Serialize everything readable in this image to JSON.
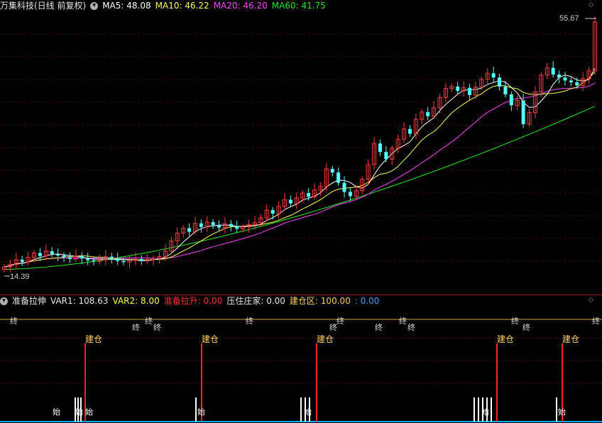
{
  "main_header": {
    "title": "万集科技(日线 前复权)",
    "ma5_label": "MA5:",
    "ma5_value": "48.08",
    "ma10_label": "MA10:",
    "ma10_value": "46.22",
    "ma20_label": "MA20:",
    "ma20_value": "46.20",
    "ma60_label": "MA60:",
    "ma60_value": "41.75"
  },
  "indicator_header": {
    "name": "准备拉伸",
    "var1_label": "VAR1:",
    "var1_value": "108.63",
    "var2_label": "VAR2:",
    "var2_value": "8.00",
    "pull_label": "准备拉升:",
    "pull_value": "0.00",
    "press_label": "压住庄家:",
    "press_value": "0.00",
    "build_label": "建仓区:",
    "build_value": "100.00",
    "extra_value": ": 0.00"
  },
  "price_labels": {
    "high": "55.67",
    "low": "14.39"
  },
  "annotations": {
    "build": "建仓",
    "start": "始",
    "end": "终"
  },
  "colors": {
    "up": "#ff3c3c",
    "down": "#54ffff",
    "ma5": "#ffffff",
    "ma10": "#ffff54",
    "ma20": "#ff44ff",
    "ma60": "#22ee22",
    "grid": "#5a1010",
    "build_bar": "#ff2020",
    "axis_line": "#00aaff"
  },
  "chart_data": {
    "type": "candlestick",
    "price_range": [
      14.39,
      55.67
    ],
    "close_series": [
      15.2,
      15.6,
      16.4,
      16.0,
      16.8,
      17.5,
      17.0,
      17.8,
      17.3,
      17.1,
      16.8,
      16.5,
      17.0,
      16.6,
      16.3,
      16.1,
      16.4,
      16.9,
      16.6,
      16.2,
      16.0,
      16.3,
      16.5,
      16.2,
      16.4,
      16.6,
      16.9,
      17.8,
      19.5,
      20.8,
      21.6,
      21.0,
      22.4,
      21.8,
      22.6,
      22.1,
      21.7,
      22.3,
      21.9,
      21.5,
      21.8,
      22.2,
      22.5,
      23.3,
      24.6,
      24.0,
      25.2,
      26.3,
      25.7,
      26.6,
      27.4,
      26.8,
      27.9,
      28.5,
      31.4,
      30.8,
      29.1,
      27.6,
      26.9,
      27.8,
      29.7,
      32.1,
      35.6,
      34.2,
      33.0,
      34.8,
      36.3,
      38.0,
      37.2,
      39.6,
      40.8,
      40.1,
      41.5,
      43.2,
      44.7,
      45.0,
      44.3,
      44.8,
      43.6,
      44.9,
      46.2,
      47.2,
      46.5,
      45.0,
      43.7,
      41.9,
      42.7,
      38.8,
      40.7,
      44.1,
      46.9,
      48.1,
      47.0,
      46.5,
      46.0,
      45.7,
      45.2,
      46.3,
      47.6,
      55.67
    ],
    "ma60_end": 41.75,
    "build_signal_positions": [
      4,
      30,
      52,
      87,
      95
    ],
    "end_signal_label": "终",
    "start_signal_label": "始"
  }
}
